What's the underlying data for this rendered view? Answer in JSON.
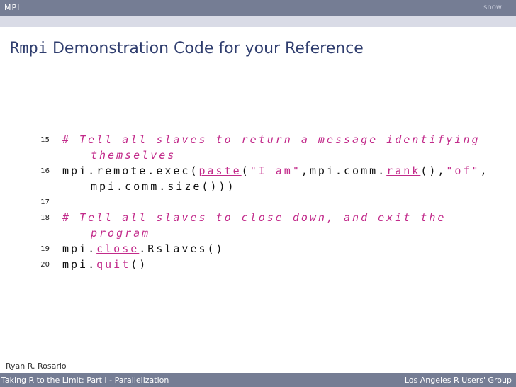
{
  "header": {
    "section_left": "MPI",
    "section_right": "snow"
  },
  "slide": {
    "title_mono": "Rmpi",
    "title_rest": " Demonstration Code for your Reference"
  },
  "code": {
    "l15": {
      "num": "15",
      "comment_a": "# Tell all slaves to return a message identifying",
      "comment_b": "themselves"
    },
    "l16": {
      "num": "16",
      "a": "mpi.remote.exec(",
      "paste": "paste",
      "b": "(",
      "s1": "\"I am\"",
      "c": ",mpi.comm.",
      "rank": "rank",
      "d": "(),",
      "s2": "\"of\"",
      "e": ",",
      "cont": "mpi.comm.size()))"
    },
    "l17": {
      "num": "17"
    },
    "l18": {
      "num": "18",
      "comment_a": "# Tell all slaves to close down, and exit the",
      "comment_b": "program"
    },
    "l19": {
      "num": "19",
      "a": "mpi.",
      "close": "close",
      "b": ".Rslaves()"
    },
    "l20": {
      "num": "20",
      "a": "mpi.",
      "quit": "quit",
      "b": "()"
    }
  },
  "footer": {
    "author": "Ryan R. Rosario",
    "title": "Taking R to the Limit: Part I - Parallelization",
    "group": "Los Angeles R Users' Group"
  }
}
